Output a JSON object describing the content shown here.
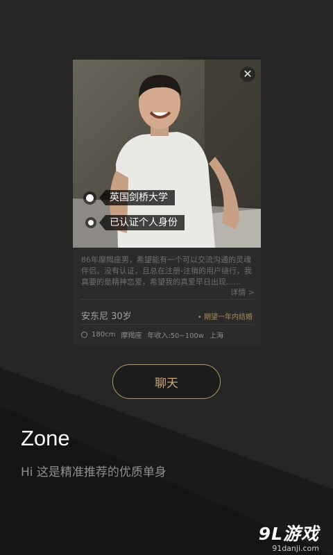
{
  "card": {
    "close_icon": "✕",
    "tags": [
      "英国剑桥大学",
      "已认证个人身份"
    ],
    "description": "86年摩羯座男，希望能有一个可以交流沟通的灵魂伴侣。没有认证，且总在注册-注销的用户绕行，我真要的是精神恋爱，希望我的真爱早日出现......",
    "detail_link": "详情 >",
    "name_age": "安东尼 30岁",
    "expectation": "• 期望一年内结婚",
    "stats": {
      "height": "180cm",
      "zodiac": "摩羯座",
      "income": "年收入:50~100w",
      "city": "上海"
    }
  },
  "chat_button": "聊天",
  "zone": {
    "title": "Zone",
    "subtitle": "Hi 这是精准推荐的优质单身"
  },
  "watermark": {
    "brand": "9L游戏",
    "url": "91danji.com"
  },
  "colors": {
    "accent_gold": "#b39669",
    "background": "#232323",
    "card": "#2b2b2b"
  }
}
